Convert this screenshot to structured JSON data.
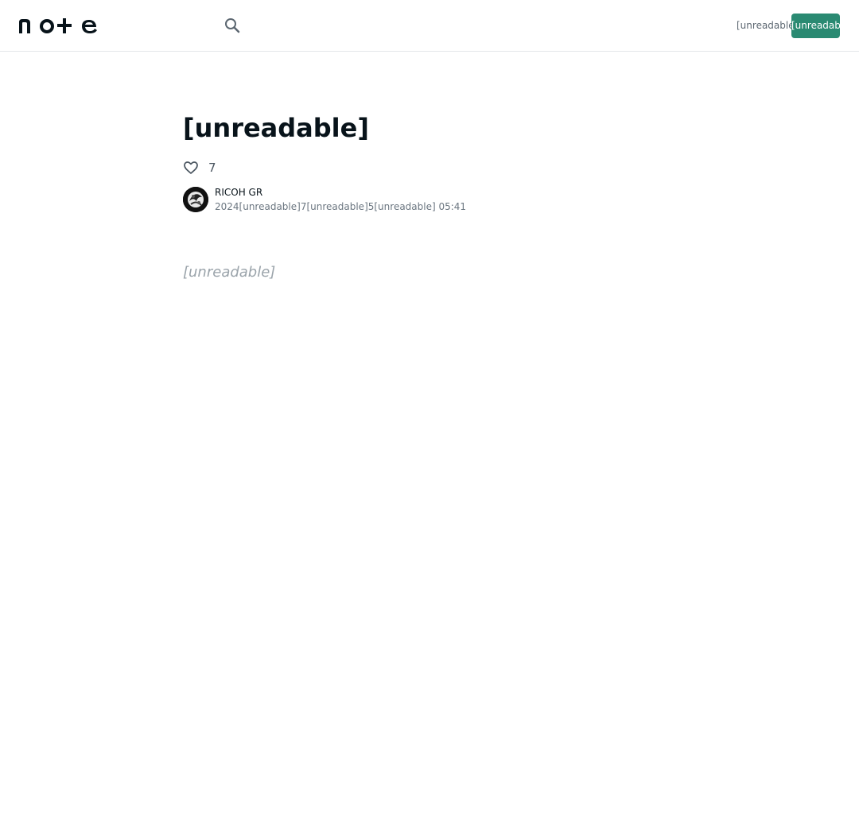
{
  "header": {
    "logo_text": "note",
    "search_icon": "search-icon",
    "login_label": "[unreadable]",
    "signup_label": "[unreadable]"
  },
  "article": {
    "title": "[unreadable]",
    "like_icon": "heart-outline-icon",
    "like_count": "7",
    "author_name": "RICOH GR",
    "date": "2024[unreadable]7[unreadable]5[unreadable] 05:41",
    "placeholder": "[unreadable]"
  },
  "colors": {
    "accent": "#2a8a72",
    "text": "#08131a",
    "muted": "#6b7680",
    "border": "#e5e7ea"
  }
}
